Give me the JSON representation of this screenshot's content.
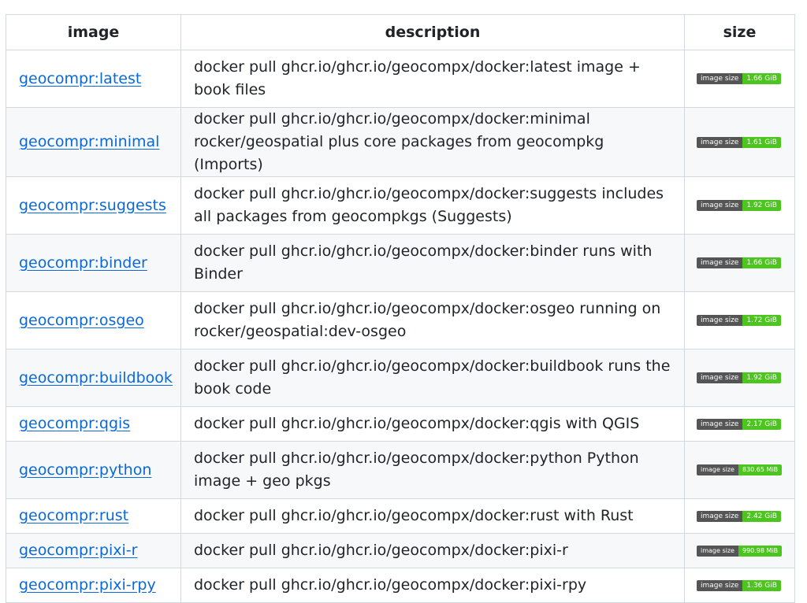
{
  "headers": {
    "image": "image",
    "description": "description",
    "size": "size"
  },
  "badge_label": "image size",
  "colors": {
    "link": "#0969da",
    "badge_label_bg": "#555555",
    "badge_value_bg": "#4cc61e",
    "row_alt_bg": "#f6f8fa",
    "border": "#d1d9e0"
  },
  "rows": [
    {
      "image": "geocompr:latest",
      "description": "docker pull ghcr.io/ghcr.io/geocompx/docker:latest image + book files",
      "size": "1.66 GiB"
    },
    {
      "image": "geocompr:minimal",
      "description": "docker pull ghcr.io/ghcr.io/geocompx/docker:minimal rocker/geospatial plus core packages from geocompkg (Imports)",
      "size": "1.61 GiB"
    },
    {
      "image": "geocompr:suggests",
      "description": "docker pull ghcr.io/ghcr.io/geocompx/docker:suggests includes all packages from geocompkgs (Suggests)",
      "size": "1.92 GiB"
    },
    {
      "image": "geocompr:binder",
      "description": "docker pull ghcr.io/ghcr.io/geocompx/docker:binder runs with Binder",
      "size": "1.66 GiB"
    },
    {
      "image": "geocompr:osgeo",
      "description": "docker pull ghcr.io/ghcr.io/geocompx/docker:osgeo running on rocker/geospatial:dev-osgeo",
      "size": "1.72 GiB"
    },
    {
      "image": "geocompr:buildbook",
      "description": "docker pull ghcr.io/ghcr.io/geocompx/docker:buildbook runs the book code",
      "size": "1.92 GiB"
    },
    {
      "image": "geocompr:qgis",
      "description": "docker pull ghcr.io/ghcr.io/geocompx/docker:qgis with QGIS",
      "size": "2.17 GiB"
    },
    {
      "image": "geocompr:python",
      "description": "docker pull ghcr.io/ghcr.io/geocompx/docker:python Python image + geo pkgs",
      "size": "830.65 MiB"
    },
    {
      "image": "geocompr:rust",
      "description": "docker pull ghcr.io/ghcr.io/geocompx/docker:rust with Rust",
      "size": "2.42 GiB"
    },
    {
      "image": "geocompr:pixi-r",
      "description": "docker pull ghcr.io/ghcr.io/geocompx/docker:pixi-r",
      "size": "990.98 MiB"
    },
    {
      "image": "geocompr:pixi-rpy",
      "description": "docker pull ghcr.io/ghcr.io/geocompx/docker:pixi-rpy",
      "size": "1.36 GiB"
    }
  ]
}
